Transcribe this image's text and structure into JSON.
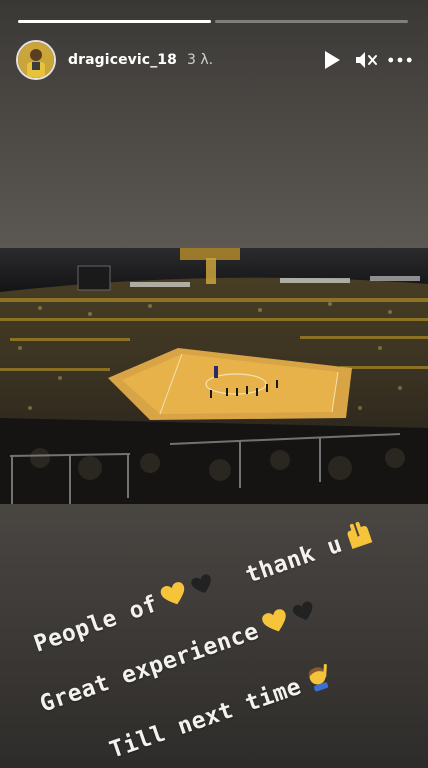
{
  "story": {
    "progress": [
      1.0,
      0.0
    ],
    "username": "dragicevic_18",
    "time": "3 λ.",
    "icons": [
      "play-icon",
      "mute-icon",
      "more-icon"
    ]
  },
  "caption": {
    "line1": "People of",
    "line2": "thank u",
    "line3": "Great experience",
    "line4": "Till next time"
  },
  "colors": {
    "heart": "#f5c43a",
    "court": "#e7b24a",
    "crowd_yellow": "#c9a227"
  }
}
